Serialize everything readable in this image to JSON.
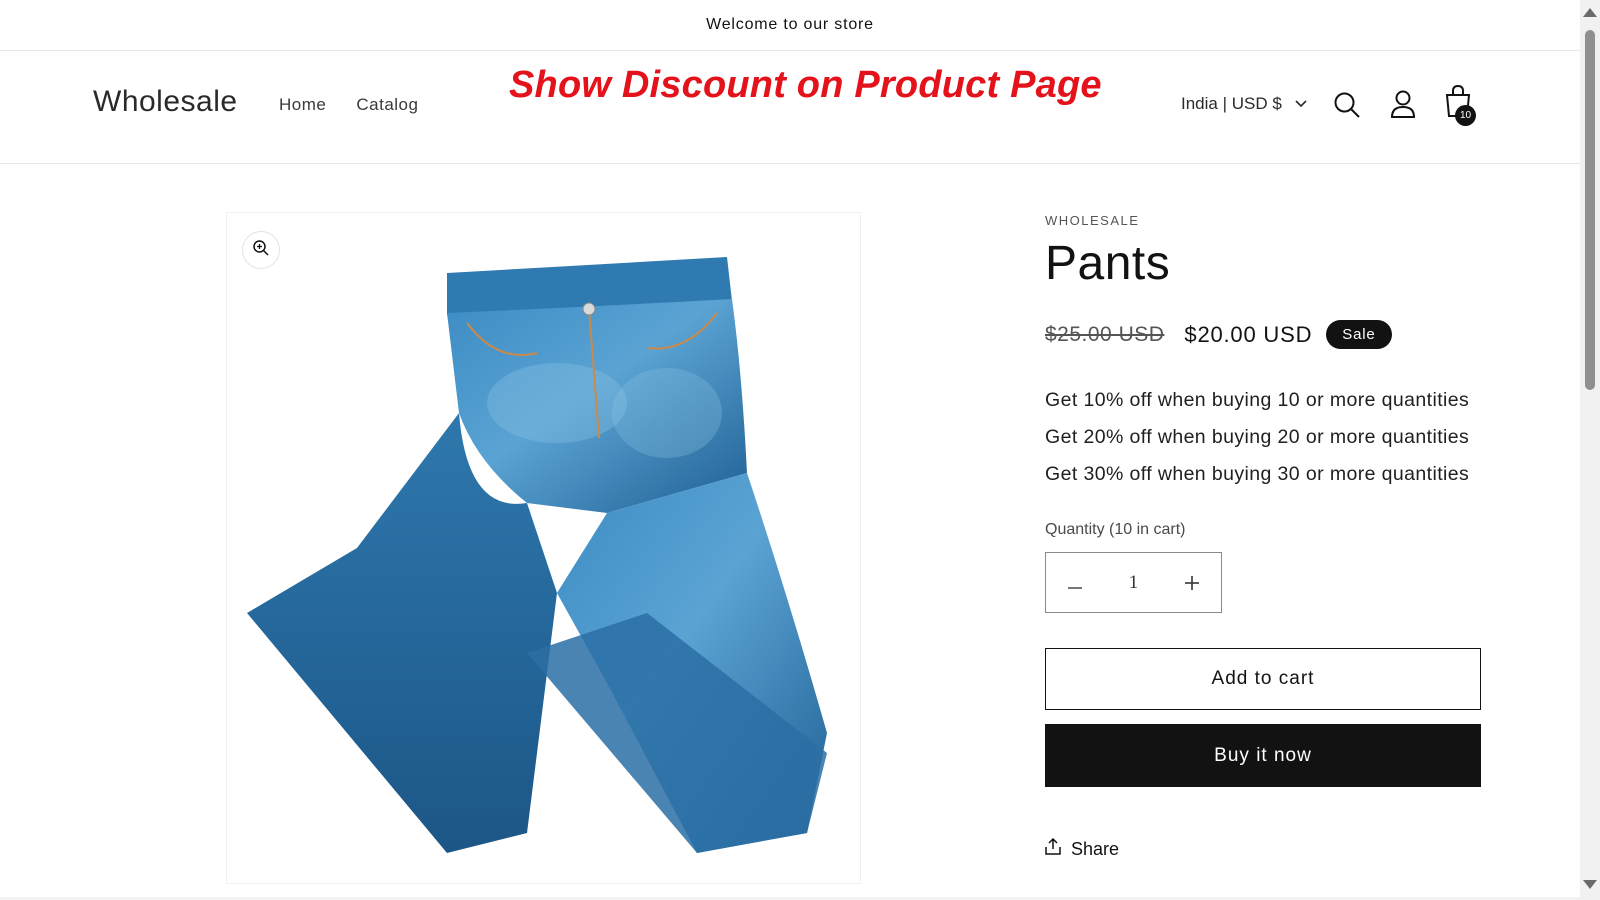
{
  "announcement": {
    "text": "Welcome to our store"
  },
  "header": {
    "logo": "Wholesale",
    "nav": [
      {
        "label": "Home"
      },
      {
        "label": "Catalog"
      }
    ],
    "promo_overlay": "Show Discount on Product Page",
    "country_selector": "India | USD $",
    "cart_count": "10",
    "icons": [
      "search-icon",
      "account-icon",
      "cart-icon",
      "chevron-down-icon"
    ]
  },
  "product": {
    "vendor": "WHOLESALE",
    "title": "Pants",
    "price_compare": "$25.00 USD",
    "price": "$20.00 USD",
    "sale_badge": "Sale",
    "discounts": [
      "Get 10% off when buying 10 or more quantities",
      "Get 20% off when buying 20 or more quantities",
      "Get 30% off when buying 30 or more quantities"
    ],
    "quantity_label": "Quantity (10 in cart)",
    "quantity_value": "1",
    "add_to_cart": "Add to cart",
    "buy_now": "Buy it now",
    "share": "Share",
    "image_alt": "Blue denim jeans"
  },
  "colors": {
    "promo_red": "#e3121b",
    "primary": "#121212",
    "denim": "#2f7fb8"
  }
}
